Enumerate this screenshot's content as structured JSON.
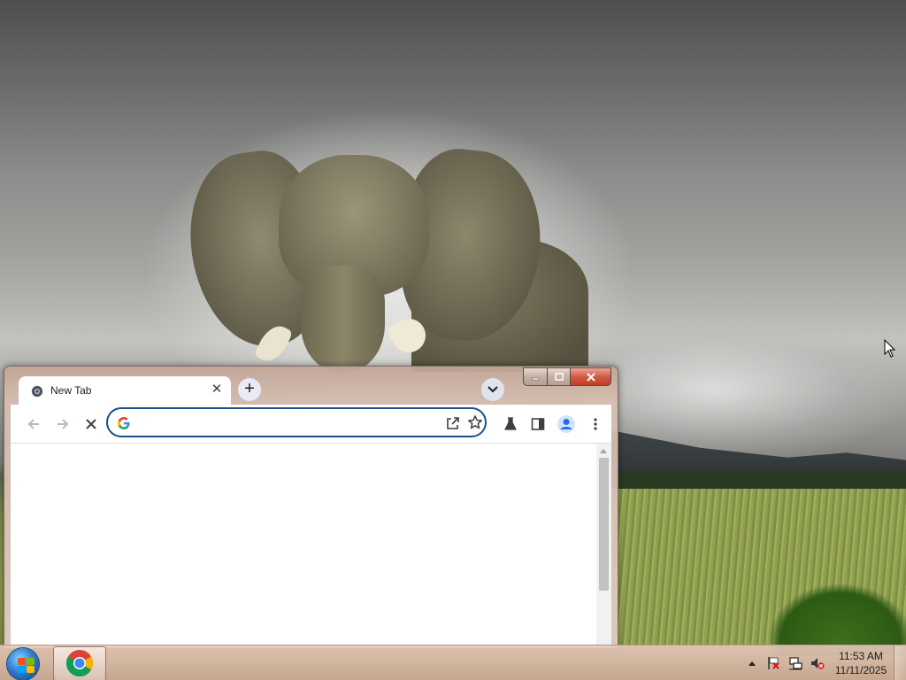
{
  "desktop": {
    "wallpaper": "elephant-savanna",
    "cursor_icon": "arrow-cursor"
  },
  "browser": {
    "tab": {
      "title": "New Tab",
      "close_glyph": "✕"
    },
    "new_tab_glyph": "+",
    "window_controls": {
      "minimize": "—",
      "maximize": "▢",
      "close": "✕"
    },
    "toolbar": {
      "back_icon": "arrow-back",
      "forward_icon": "arrow-forward",
      "stop_icon": "close",
      "omnibox": {
        "value": "",
        "placeholder": ""
      },
      "share_icon": "share",
      "bookmark_icon": "star",
      "labs_icon": "flask",
      "side_panel_icon": "side-panel",
      "profile_icon": "person",
      "menu_icon": "more-vertical"
    },
    "colors": {
      "omnibox_border": "#1a4f8b",
      "profile": "#1a73e8"
    }
  },
  "taskbar": {
    "clock": {
      "time": "11:53 AM",
      "date": "11/11/2025"
    },
    "tray": [
      "show-hidden-icons",
      "action-center-flag",
      "network",
      "volume-muted"
    ]
  }
}
